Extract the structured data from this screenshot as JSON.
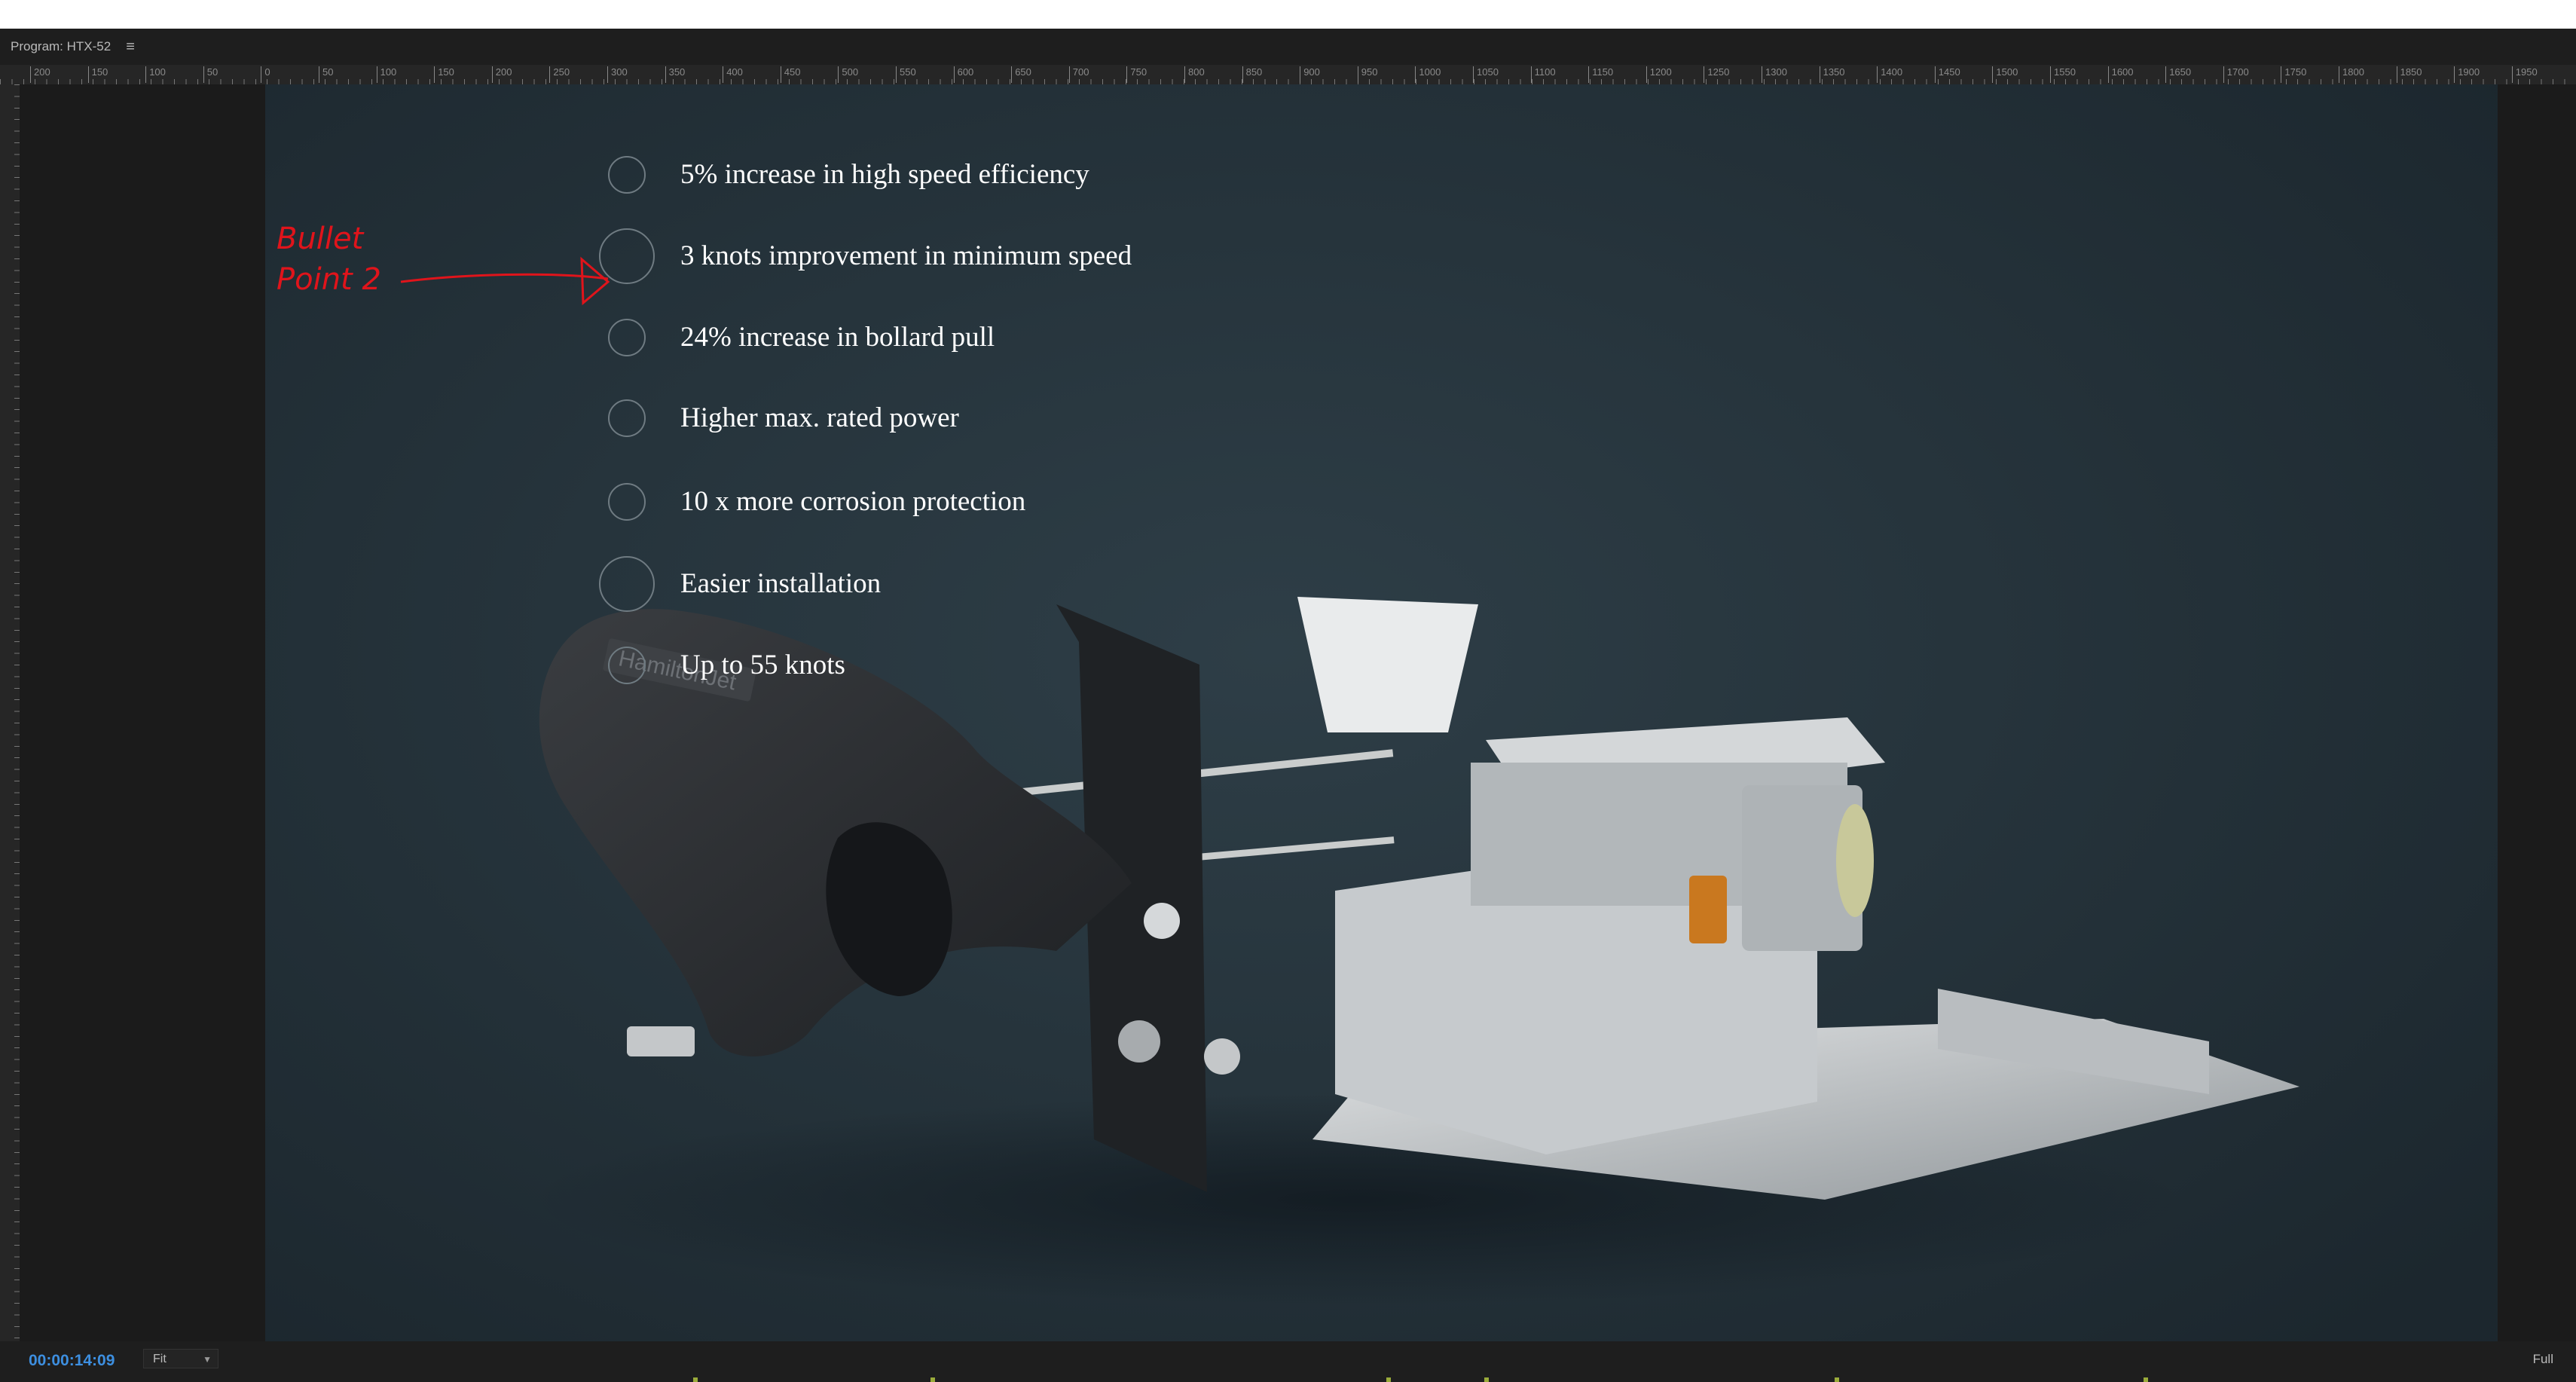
{
  "panel": {
    "title": "Program: HTX-52",
    "menu_icon": "hamburger-menu-icon"
  },
  "ruler": {
    "ticks": [
      "200",
      "150",
      "100",
      "50",
      "0",
      "50",
      "100",
      "150",
      "200",
      "250",
      "300",
      "350",
      "400",
      "450",
      "500",
      "550",
      "600",
      "650",
      "700",
      "750",
      "800",
      "850",
      "900",
      "950",
      "1000",
      "1050",
      "1100",
      "1150",
      "1200",
      "1250",
      "1300",
      "1350",
      "1400",
      "1450",
      "1500",
      "1550",
      "1600",
      "1650",
      "1700",
      "1750",
      "1800",
      "1850",
      "1900",
      "1950"
    ]
  },
  "slide": {
    "bullets": [
      {
        "text": "5% increase in high speed efficiency",
        "ring": "small"
      },
      {
        "text": "3 knots improvement in minimum speed",
        "ring": "large"
      },
      {
        "text": "24% increase in bollard pull",
        "ring": "small"
      },
      {
        "text": "Higher max. rated power",
        "ring": "small"
      },
      {
        "text": "10 x more corrosion protection",
        "ring": "small"
      },
      {
        "text": "Easier installation",
        "ring": "large"
      },
      {
        "text": "Up to 55 knots",
        "ring": "small"
      }
    ],
    "annotation": {
      "line1": "Bullet",
      "line2": "Point 2",
      "color": "#e0141b"
    },
    "render_brand": "HamiltonJet"
  },
  "footer": {
    "timecode": "00:00:14:09",
    "zoom": "Fit",
    "resolution": "Full"
  },
  "colors": {
    "timecode": "#3d8fe0",
    "background": "#26343c"
  }
}
